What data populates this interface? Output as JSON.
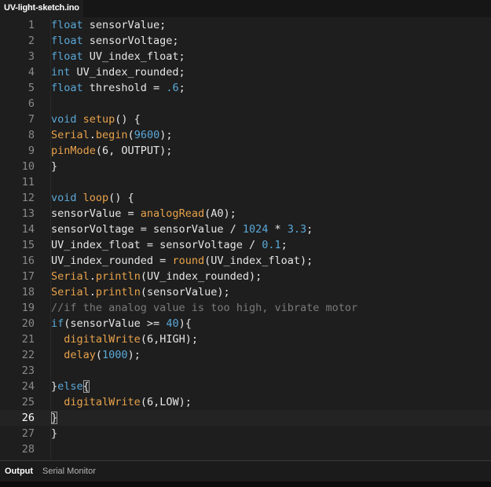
{
  "editor": {
    "tab_title": "UV-light-sketch.ino",
    "current_line": 26,
    "lines": [
      [
        {
          "t": "float",
          "c": "type"
        },
        {
          "t": " sensorValue;"
        }
      ],
      [
        {
          "t": "float",
          "c": "type"
        },
        {
          "t": " sensorVoltage;"
        }
      ],
      [
        {
          "t": "float",
          "c": "type"
        },
        {
          "t": " UV_index_float;"
        }
      ],
      [
        {
          "t": "int",
          "c": "type"
        },
        {
          "t": " UV_index_rounded;"
        }
      ],
      [
        {
          "t": "float",
          "c": "type"
        },
        {
          "t": " threshold = "
        },
        {
          "t": ".6",
          "c": "num"
        },
        {
          "t": ";"
        }
      ],
      [],
      [
        {
          "t": "void",
          "c": "type"
        },
        {
          "t": " "
        },
        {
          "t": "setup",
          "c": "fn"
        },
        {
          "t": "() {"
        }
      ],
      [
        {
          "t": "Serial",
          "c": "fn"
        },
        {
          "t": "."
        },
        {
          "t": "begin",
          "c": "fn"
        },
        {
          "t": "("
        },
        {
          "t": "9600",
          "c": "num"
        },
        {
          "t": ");"
        }
      ],
      [
        {
          "t": "pinMode",
          "c": "fn"
        },
        {
          "t": "(6, OUTPUT);"
        }
      ],
      [
        {
          "t": "}"
        }
      ],
      [],
      [
        {
          "t": "void",
          "c": "type"
        },
        {
          "t": " "
        },
        {
          "t": "loop",
          "c": "fn"
        },
        {
          "t": "() {"
        }
      ],
      [
        {
          "t": "sensorValue = "
        },
        {
          "t": "analogRead",
          "c": "fn"
        },
        {
          "t": "(A0);"
        }
      ],
      [
        {
          "t": "sensorVoltage = sensorValue / "
        },
        {
          "t": "1024",
          "c": "num"
        },
        {
          "t": " * "
        },
        {
          "t": "3.3",
          "c": "num"
        },
        {
          "t": ";"
        }
      ],
      [
        {
          "t": "UV_index_float = sensorVoltage / "
        },
        {
          "t": "0.1",
          "c": "num"
        },
        {
          "t": ";"
        }
      ],
      [
        {
          "t": "UV_index_rounded = "
        },
        {
          "t": "round",
          "c": "fn"
        },
        {
          "t": "(UV_index_float);"
        }
      ],
      [
        {
          "t": "Serial",
          "c": "fn"
        },
        {
          "t": "."
        },
        {
          "t": "println",
          "c": "fn"
        },
        {
          "t": "(UV_index_rounded);"
        }
      ],
      [
        {
          "t": "Serial",
          "c": "fn"
        },
        {
          "t": "."
        },
        {
          "t": "println",
          "c": "fn"
        },
        {
          "t": "(sensorValue);"
        }
      ],
      [
        {
          "t": "//if the analog value is too high, vibrate motor",
          "c": "cmt"
        }
      ],
      [
        {
          "t": "if",
          "c": "type"
        },
        {
          "t": "(sensorValue >= "
        },
        {
          "t": "40",
          "c": "num"
        },
        {
          "t": "){"
        }
      ],
      [
        {
          "t": "  "
        },
        {
          "t": "digitalWrite",
          "c": "fn"
        },
        {
          "t": "(6,HIGH);"
        }
      ],
      [
        {
          "t": "  "
        },
        {
          "t": "delay",
          "c": "fn"
        },
        {
          "t": "("
        },
        {
          "t": "1000",
          "c": "num"
        },
        {
          "t": ");"
        }
      ],
      [],
      [
        {
          "t": "}"
        },
        {
          "t": "else",
          "c": "type"
        },
        {
          "t": "{",
          "c": "brk"
        }
      ],
      [
        {
          "t": "  "
        },
        {
          "t": "digitalWrite",
          "c": "fn"
        },
        {
          "t": "(6,LOW);"
        }
      ],
      [
        {
          "t": "}",
          "c": "brk"
        }
      ],
      [
        {
          "t": "}"
        }
      ],
      []
    ]
  },
  "panel": {
    "output_label": "Output",
    "serial_monitor_label": "Serial Monitor"
  },
  "colors": {
    "keyword": "#5aa8d8",
    "function": "#e8a24a",
    "number": "#5aa8d8",
    "comment": "#7a7a7a",
    "text": "#e6e6e6",
    "background": "#1e1e1e"
  }
}
